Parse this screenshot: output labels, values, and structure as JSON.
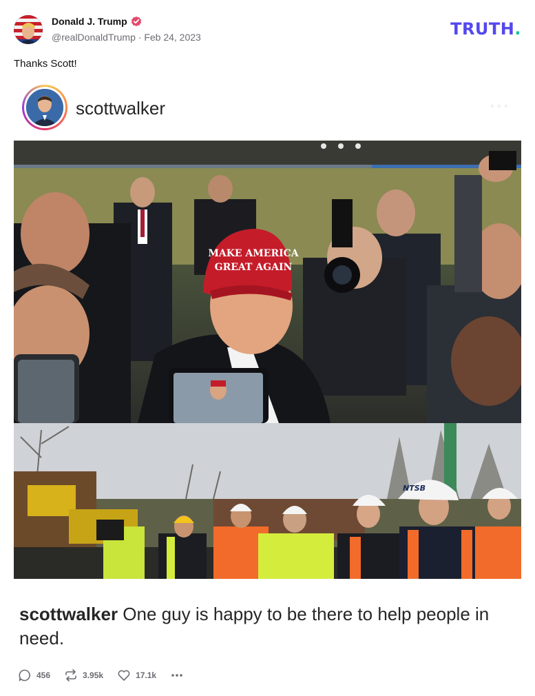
{
  "post": {
    "author": {
      "display_name": "Donald J. Trump",
      "handle": "@realDonaldTrump",
      "separator": "·",
      "date": "Feb 24, 2023",
      "verified": true
    },
    "brand": {
      "logo_text": "TRUTH",
      "logo_dot": ".",
      "logo_color": "#5448ee",
      "dot_color": "#15c1a4"
    },
    "text": "Thanks Scott!",
    "media": {
      "ig_username": "scottwalker",
      "caption_user": "scottwalker",
      "caption_text": " One guy is happy to be there to help people in need."
    },
    "actions": {
      "replies": "456",
      "retruths": "3.95k",
      "likes": "17.1k"
    }
  },
  "icons": [
    "verified-badge-icon",
    "reply-icon",
    "retruth-icon",
    "like-icon",
    "more-icon"
  ]
}
